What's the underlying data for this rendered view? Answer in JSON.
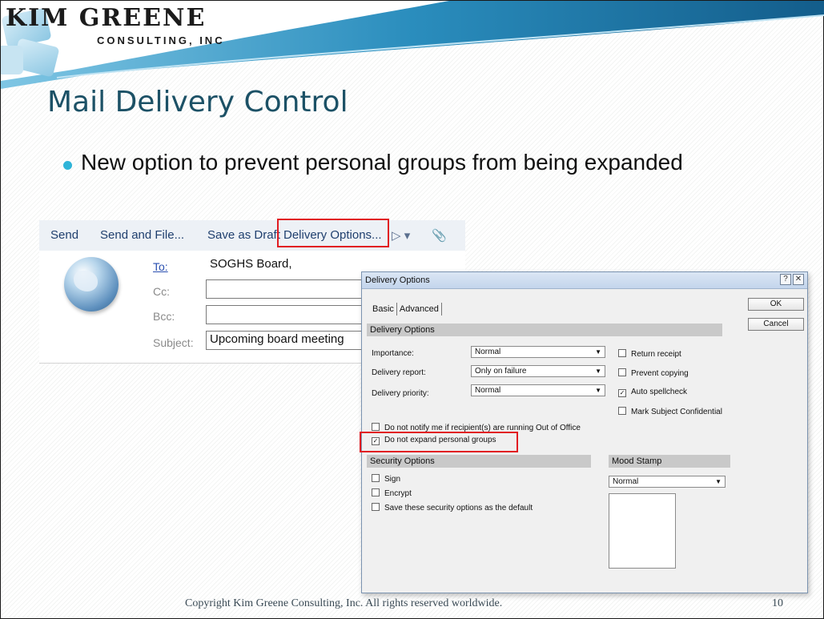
{
  "logo": {
    "name": "KIM GREENE",
    "sub": "CONSULTING, INC"
  },
  "slide_title": "Mail Delivery Control",
  "bullet": "New option to prevent personal groups from being expanded",
  "footer": "Copyright Kim Greene Consulting, Inc.  All rights reserved worldwide.",
  "page_number": "10",
  "mail": {
    "toolbar": {
      "send": "Send",
      "send_and_file": "Send and File...",
      "save_as_draft": "Save as Draft",
      "delivery_options": "Delivery Options...",
      "flag_icon": "▷ ▾",
      "attach_icon": "📎"
    },
    "fields": {
      "to_label": "To:",
      "to_value": "SOGHS Board,",
      "cc_label": "Cc:",
      "cc_value": "",
      "bcc_label": "Bcc:",
      "bcc_value": "",
      "subject_label": "Subject:",
      "subject_value": "Upcoming board meeting"
    }
  },
  "dialog": {
    "title": "Delivery Options",
    "help_button": "?",
    "close_button": "✕",
    "tabs": [
      "Basic",
      "Advanced"
    ],
    "ok": "OK",
    "cancel": "Cancel",
    "delivery_section": "Delivery Options",
    "importance_label": "Importance:",
    "importance_value": "Normal",
    "report_label": "Delivery report:",
    "report_value": "Only on failure",
    "priority_label": "Delivery priority:",
    "priority_value": "Normal",
    "return_receipt": "Return receipt",
    "prevent_copying": "Prevent copying",
    "auto_spellcheck": "Auto spellcheck",
    "mark_confidential": "Mark Subject Confidential",
    "no_notify_ooo": "Do not notify me if recipient(s) are running Out of Office",
    "no_expand_groups": "Do not expand personal groups",
    "security_section": "Security Options",
    "sign": "Sign",
    "encrypt": "Encrypt",
    "save_security_default": "Save these security options as the default",
    "mood_section": "Mood Stamp",
    "mood_value": "Normal",
    "checked_mark": "✓",
    "checkbox_state": {
      "return_receipt": false,
      "prevent_copying": false,
      "auto_spellcheck": true,
      "mark_confidential": false,
      "no_notify_ooo": false,
      "no_expand_groups": true,
      "sign": false,
      "encrypt": false,
      "save_security_default": false
    }
  },
  "colors": {
    "title": "#1c5166",
    "bullet": "#2fb4d8",
    "highlight": "#e11c22",
    "toolbar_text": "#1f3f6e"
  }
}
